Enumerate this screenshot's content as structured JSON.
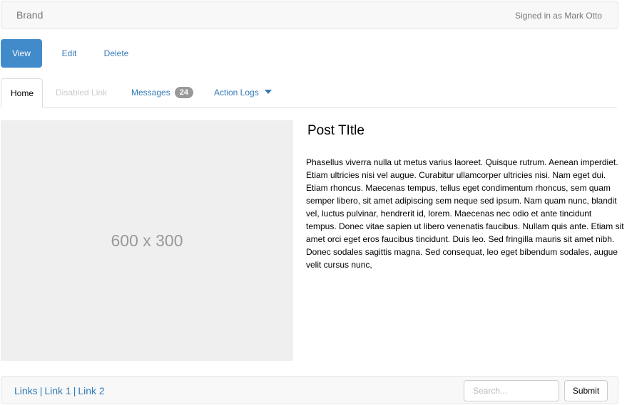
{
  "navbar": {
    "brand": "Brand",
    "signed_in": "Signed in as Mark Otto"
  },
  "pills": {
    "items": [
      {
        "label": "View",
        "active": true
      },
      {
        "label": "Edit",
        "active": false
      },
      {
        "label": "Delete",
        "active": false
      }
    ]
  },
  "tabs": {
    "home": "Home",
    "disabled": "Disabled Link",
    "messages": "Messages",
    "messages_badge": "24",
    "action_logs": "Action Logs"
  },
  "placeholder": {
    "text": "600 x 300"
  },
  "post": {
    "title": "Post TItle",
    "body": "Phasellus viverra nulla ut metus varius laoreet. Quisque rutrum. Aenean imperdiet. Etiam ultricies nisi vel augue. Curabitur ullamcorper ultricies nisi. Nam eget dui. Etiam rhoncus. Maecenas tempus, tellus eget condimentum rhoncus, sem quam semper libero, sit amet adipiscing sem neque sed ipsum. Nam quam nunc, blandit vel, luctus pulvinar, hendrerit id, lorem. Maecenas nec odio et ante tincidunt tempus. Donec vitae sapien ut libero venenatis faucibus. Nullam quis ante. Etiam sit amet orci eget eros faucibus tincidunt. Duis leo. Sed fringilla mauris sit amet nibh. Donec sodales sagittis magna. Sed consequat, leo eget bibendum sodales, augue velit cursus nunc,"
  },
  "footer": {
    "links": [
      "Links",
      "Link 1",
      "Link 2"
    ],
    "separator": "|",
    "search_placeholder": "Search...",
    "submit_label": "Submit"
  },
  "colors": {
    "accent": "#428bca",
    "link": "#337ab7",
    "badge": "#999999"
  }
}
